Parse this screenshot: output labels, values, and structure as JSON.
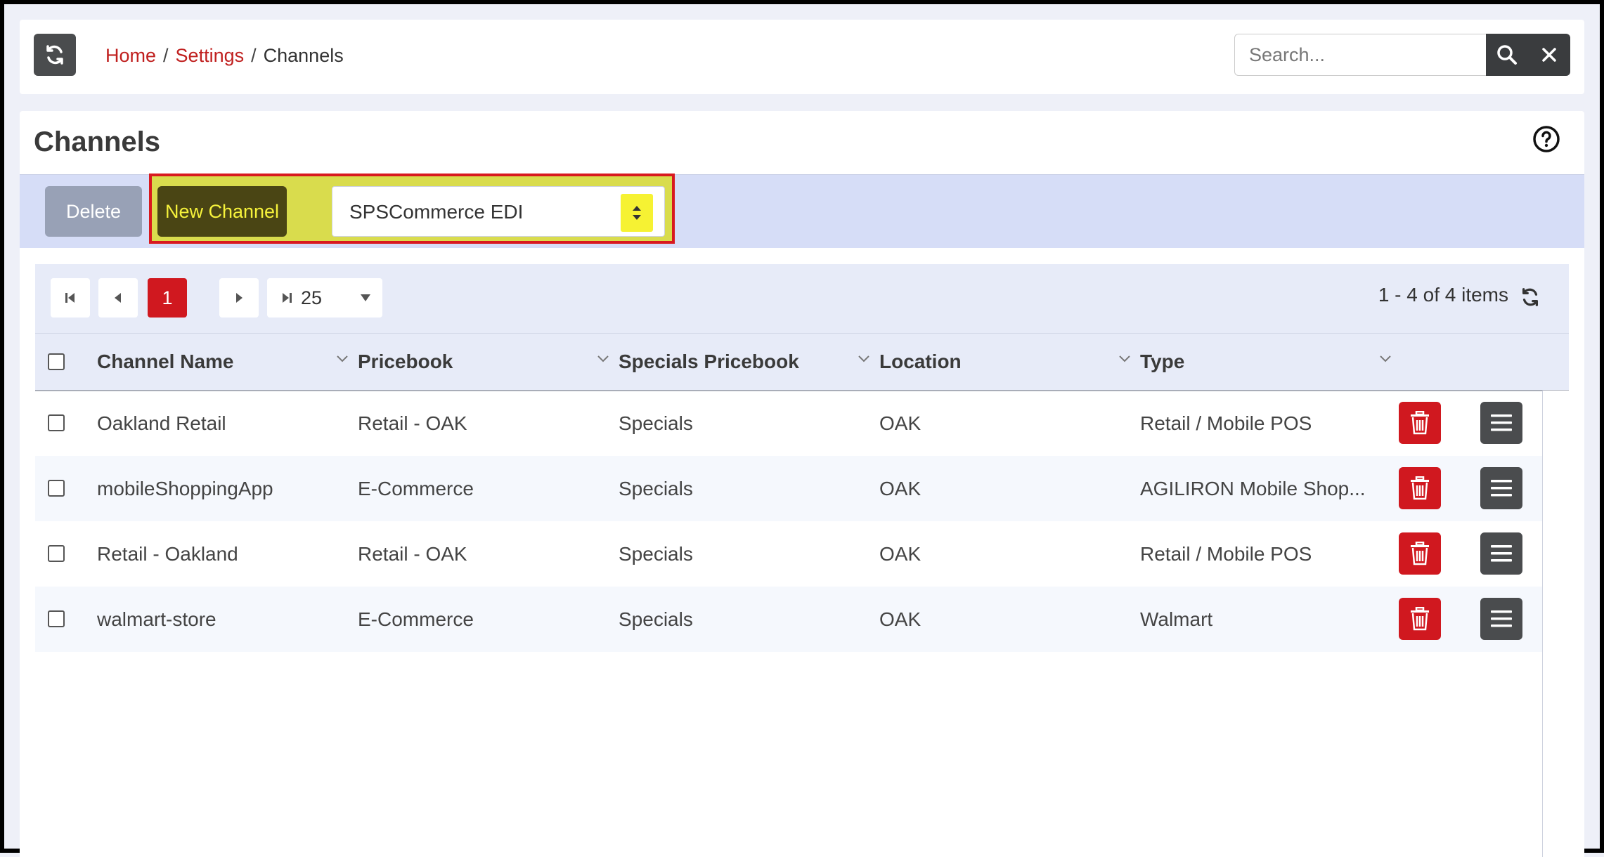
{
  "breadcrumb": {
    "home": "Home",
    "settings": "Settings",
    "current": "Channels",
    "sep": "/"
  },
  "search": {
    "placeholder": "Search..."
  },
  "page": {
    "title": "Channels"
  },
  "toolbar": {
    "delete_label": "Delete",
    "new_channel_label": "New Channel",
    "channel_type_selected": "SPSCommerce EDI"
  },
  "pager": {
    "current_page": "1",
    "page_size": "25",
    "items_info": "1 - 4 of 4 items"
  },
  "table": {
    "columns": [
      "Channel Name",
      "Pricebook",
      "Specials Pricebook",
      "Location",
      "Type"
    ],
    "rows": [
      {
        "name": "Oakland Retail",
        "pricebook": "Retail - OAK",
        "specials": "Specials",
        "location": "OAK",
        "type": "Retail / Mobile POS"
      },
      {
        "name": "mobileShoppingApp",
        "pricebook": "E-Commerce",
        "specials": "Specials",
        "location": "OAK",
        "type": "AGILIRON Mobile Shop..."
      },
      {
        "name": "Retail - Oakland",
        "pricebook": "Retail - OAK",
        "specials": "Specials",
        "location": "OAK",
        "type": "Retail / Mobile POS"
      },
      {
        "name": "walmart-store",
        "pricebook": "E-Commerce",
        "specials": "Specials",
        "location": "OAK",
        "type": "Walmart"
      }
    ]
  },
  "colors": {
    "accent_red": "#d0181f",
    "highlight_yellow": "#f6f23b",
    "dark_button": "#4a4c4e"
  }
}
